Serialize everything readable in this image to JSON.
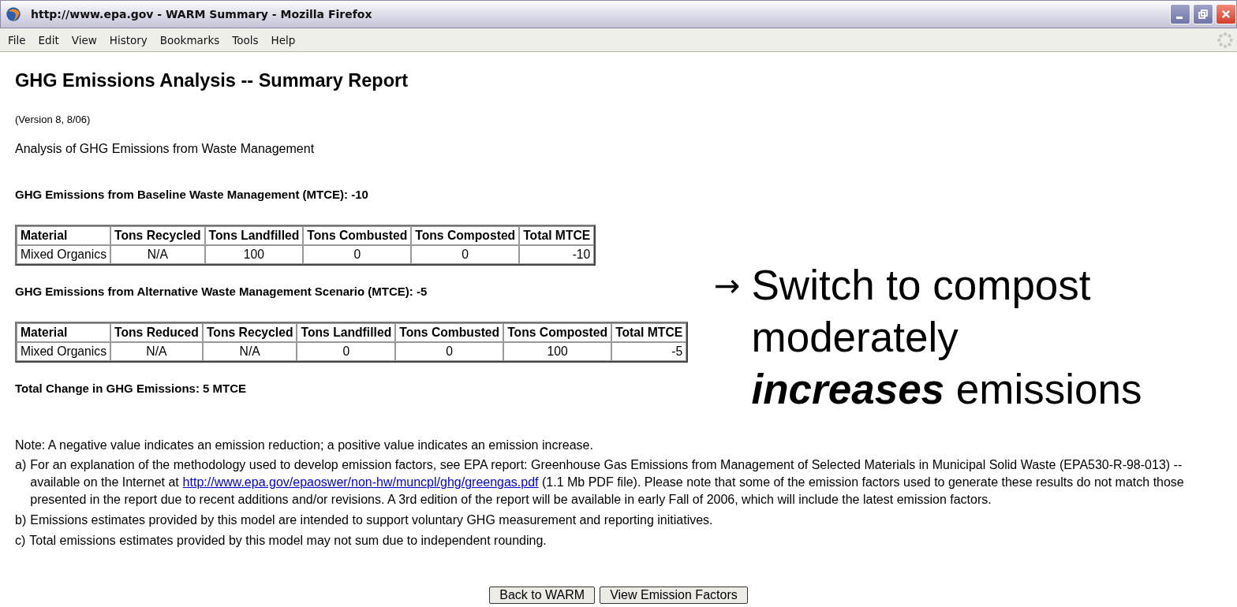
{
  "window": {
    "title": "http://www.epa.gov - WARM Summary - Mozilla Firefox"
  },
  "menu": [
    "File",
    "Edit",
    "View",
    "History",
    "Bookmarks",
    "Tools",
    "Help"
  ],
  "page": {
    "heading": "GHG Emissions Analysis -- Summary Report",
    "version": "(Version 8, 8/06)",
    "subtitle": "Analysis of GHG Emissions from Waste Management",
    "sections": [
      {
        "title": "GHG Emissions from Baseline Waste Management (MTCE): -10",
        "columns": [
          "Material",
          "Tons Recycled",
          "Tons Landfilled",
          "Tons Combusted",
          "Tons Composted",
          "Total MTCE"
        ],
        "rows": [
          [
            "Mixed Organics",
            "N/A",
            "100",
            "0",
            "0",
            "-10"
          ]
        ]
      },
      {
        "title": "GHG Emissions from Alternative Waste Management Scenario (MTCE): -5",
        "columns": [
          "Material",
          "Tons Reduced",
          "Tons Recycled",
          "Tons Landfilled",
          "Tons Combusted",
          "Tons Composted",
          "Total MTCE"
        ],
        "rows": [
          [
            "Mixed Organics",
            "N/A",
            "N/A",
            "0",
            "0",
            "100",
            "-5"
          ]
        ]
      }
    ],
    "total": "Total Change in GHG Emissions: 5 MTCE",
    "note": "Note: A negative value indicates an emission reduction; a positive value indicates an emission increase.",
    "footnotes": [
      {
        "marker": "a)",
        "before": "For an explanation of the methodology used to develop emission factors, see EPA report: Greenhouse Gas Emissions from Management of Selected Materials in Municipal Solid Waste (EPA530-R-98-013) -- available on the Internet at",
        "link": "http://www.epa.gov/epaoswer/non-hw/muncpl/ghg/greengas.pdf",
        "after": "(1.1 Mb PDF file). Please note that some of the emission factors used to generate these results do not match those presented in the report due to recent additions and/or revisions. A 3rd edition of the report will be available in early Fall of 2006, which will include the latest emission factors."
      },
      {
        "marker": "b)",
        "before": "Emissions estimates provided by this model are intended to support voluntary GHG measurement and reporting initiatives."
      },
      {
        "marker": "c)",
        "before": "Total emissions estimates provided by this model may not sum due to independent rounding."
      }
    ],
    "buttons": [
      "Back to WARM",
      "View Emission Factors"
    ]
  },
  "callout": {
    "arrow": "→",
    "lines": [
      "Switch to compost",
      "moderately",
      "**increases** emissions"
    ]
  }
}
